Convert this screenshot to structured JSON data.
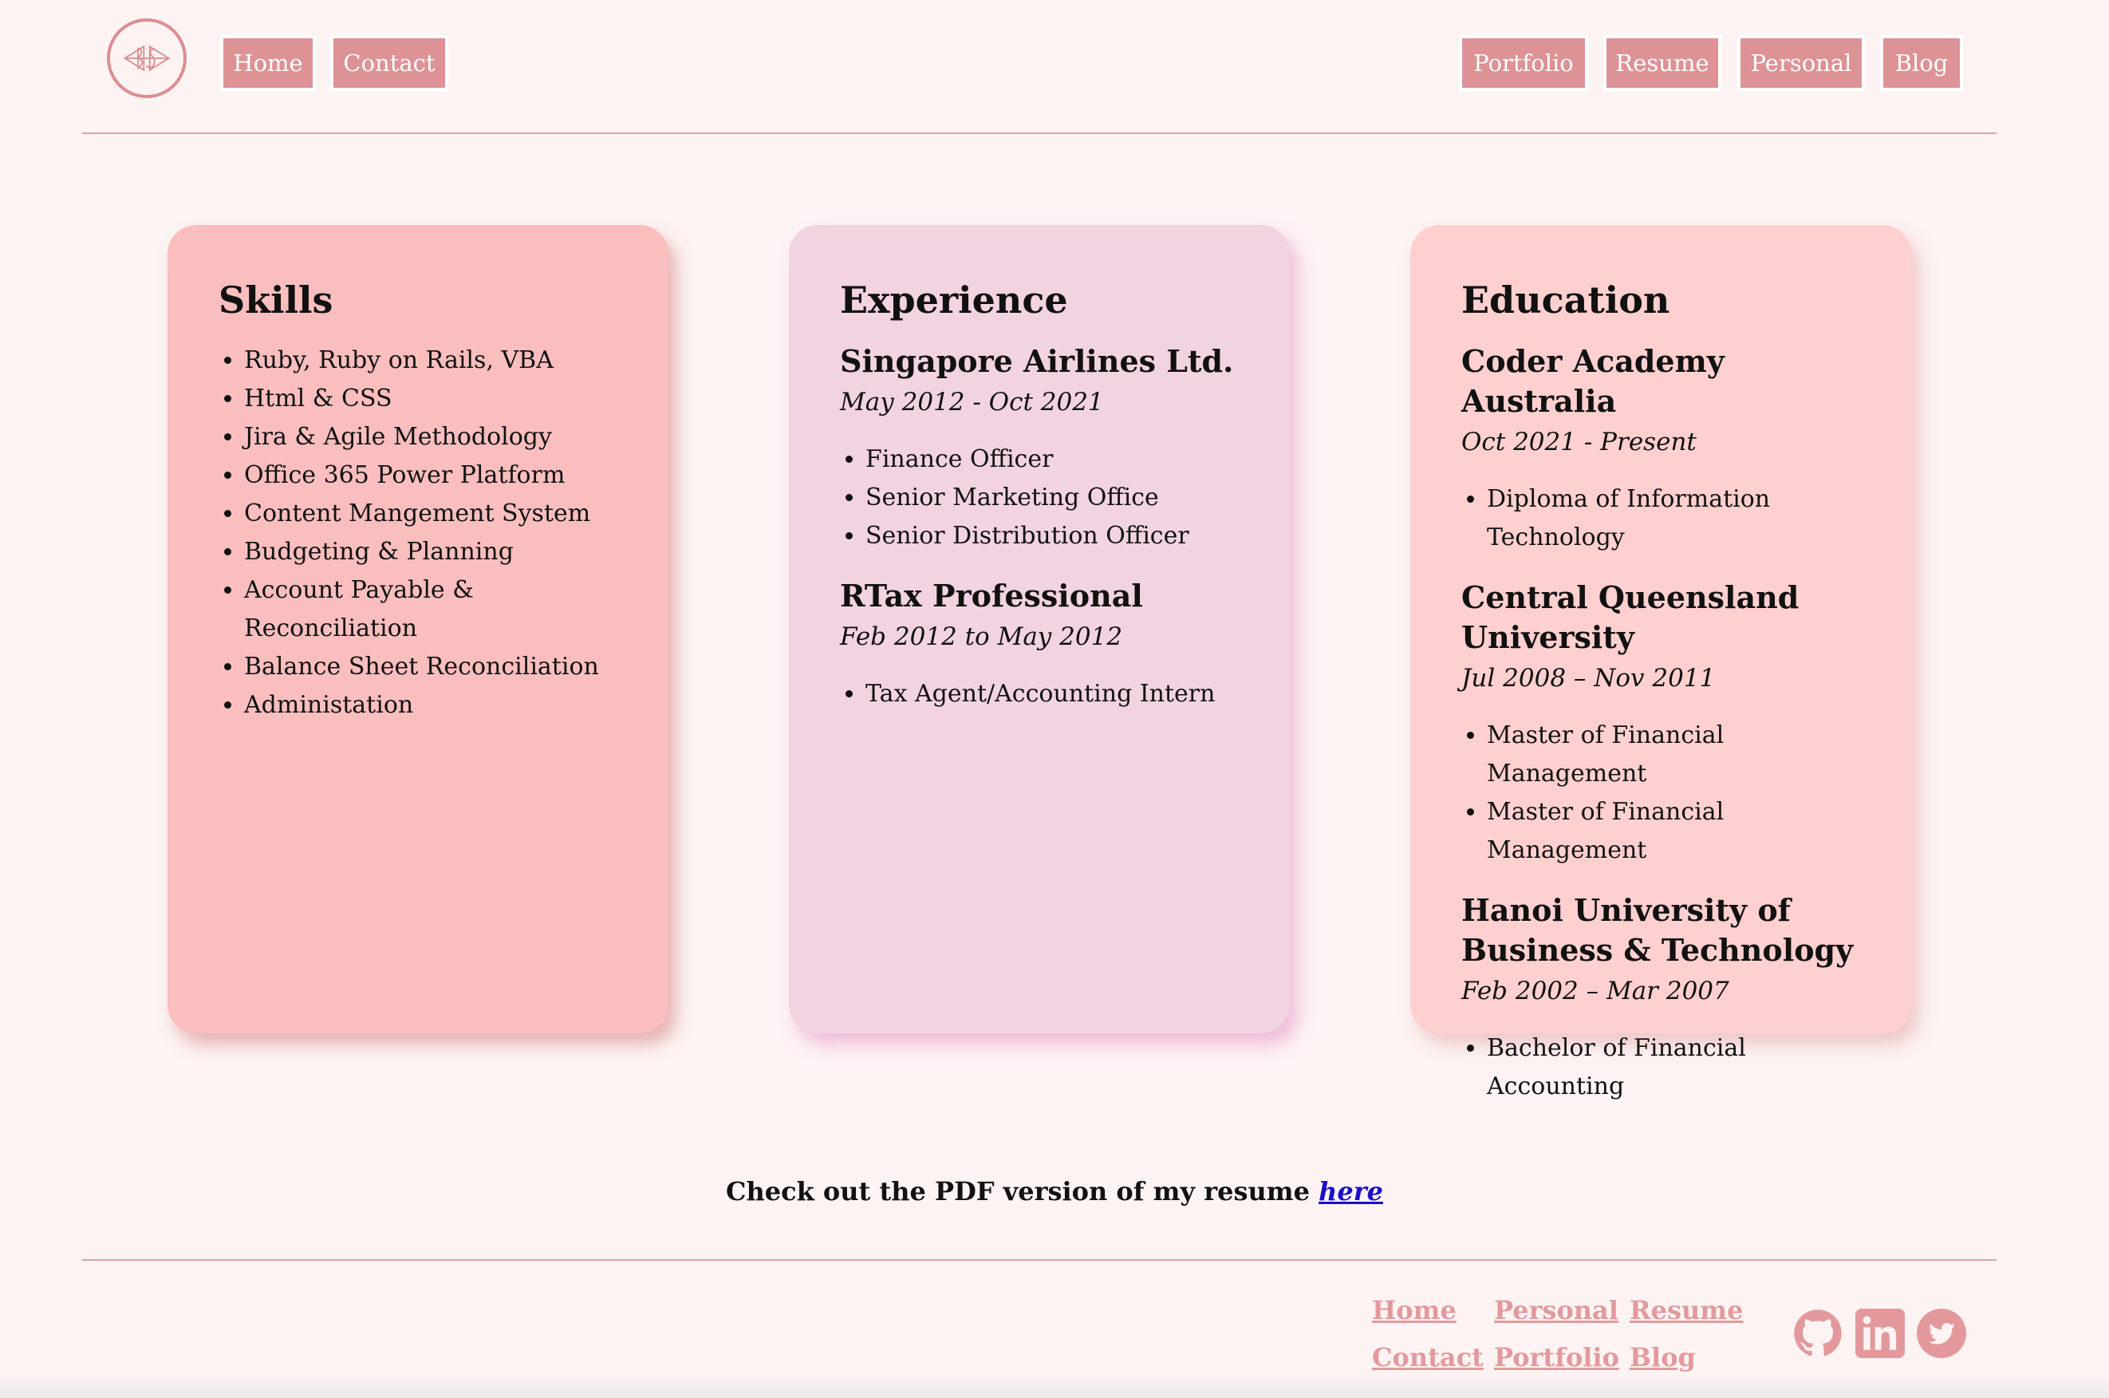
{
  "header": {
    "nav_left": [
      "Home",
      "Contact"
    ],
    "nav_right": [
      "Portfolio",
      "Resume",
      "Personal",
      "Blog"
    ]
  },
  "cards": {
    "skills": {
      "title": "Skills",
      "items": [
        "Ruby, Ruby on Rails, VBA",
        "Html & CSS",
        "Jira & Agile Methodology",
        "Office 365 Power Platform",
        "Content Mangement System",
        "Budgeting & Planning",
        "Account Payable & Reconciliation",
        "Balance Sheet Reconciliation",
        "Administation"
      ]
    },
    "experience": {
      "title": "Experience",
      "entries": [
        {
          "org": "Singapore Airlines Ltd.",
          "period": "May 2012 - Oct 2021",
          "items": [
            "Finance Officer",
            "Senior Marketing Office",
            "Senior Distribution Officer"
          ]
        },
        {
          "org": "RTax Professional",
          "period": "Feb 2012 to May 2012",
          "items": [
            "Tax Agent/Accounting Intern"
          ]
        }
      ]
    },
    "education": {
      "title": "Education",
      "entries": [
        {
          "org": "Coder Academy Australia",
          "period": "Oct 2021 - Present",
          "items": [
            "Diploma of Information Technology"
          ]
        },
        {
          "org": "Central Queensland University",
          "period": "Jul 2008 – Nov 2011",
          "items": [
            "Master of Financial Management",
            "Master of Financial Management"
          ]
        },
        {
          "org": "Hanoi University of Business & Technology",
          "period": "Feb 2002 – Mar 2007",
          "items": [
            "Bachelor of Financial Accounting"
          ]
        }
      ]
    }
  },
  "pdf": {
    "text": "Check out the PDF version of my resume",
    "link": "here"
  },
  "footer": {
    "links": {
      "home": "Home",
      "personal": "Personal",
      "resume": "Resume",
      "contact": "Contact",
      "portfolio": "Portfolio",
      "blog": "Blog"
    },
    "social_icons": [
      "github-icon",
      "linkedin-icon",
      "twitter-icon"
    ]
  },
  "colors": {
    "background": "#fdf3f3",
    "accent": "#dd9295",
    "skills_card": "#f9bebd",
    "experience_card": "#f2d3e2",
    "education_card": "#ffd0cf",
    "link": "#1a0dcc"
  }
}
